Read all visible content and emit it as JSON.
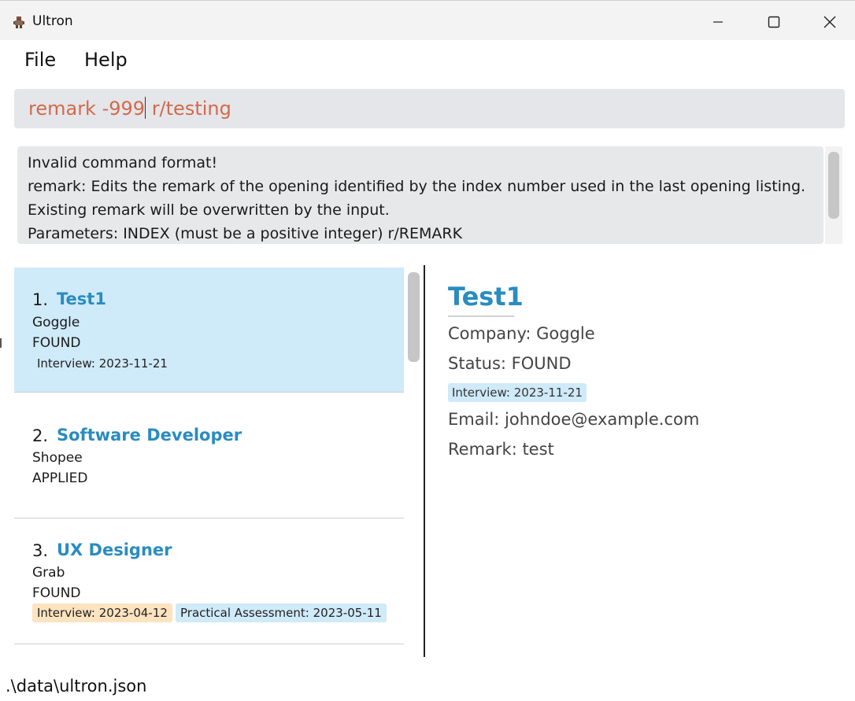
{
  "window": {
    "title": "Ultron",
    "app_icon": "ultron-robot-icon"
  },
  "menu": {
    "file": "File",
    "help": "Help"
  },
  "command": {
    "value_before_caret": "remark -999",
    "value_after_caret": " r/testing"
  },
  "result": {
    "lines": [
      "Invalid command format!",
      "remark: Edits the remark of the opening identified by the index number used in the last opening listing.",
      "Existing remark will be overwritten by the input.",
      "Parameters: INDEX (must be a positive integer) r/REMARK"
    ]
  },
  "openings": [
    {
      "index": "1.",
      "title": "Test1",
      "company": "Goggle",
      "status": "FOUND",
      "dates": [
        "Interview: 2023-11-21"
      ],
      "selected": true
    },
    {
      "index": "2.",
      "title": "Software Developer",
      "company": "Shopee",
      "status": "APPLIED",
      "dates": []
    },
    {
      "index": "3.",
      "title": "UX Designer",
      "company": "Grab",
      "status": "FOUND",
      "dates": [
        "Interview: 2023-04-12",
        "Practical Assessment: 2023-05-11"
      ]
    }
  ],
  "detail": {
    "title": "Test1",
    "company": "Company: Goggle",
    "status": "Status: FOUND",
    "date_tag": "Interview: 2023-11-21",
    "email": "Email: johndoe@example.com",
    "remark": "Remark: test"
  },
  "status_bar": {
    "path": ".\\data\\ultron.json"
  },
  "colors": {
    "accent": "#2a8cbf",
    "selected_card": "#cfeaf8",
    "command_text": "#d4694c",
    "tag_orange": "#fde3bf",
    "tag_blue": "#cfeaf8"
  }
}
